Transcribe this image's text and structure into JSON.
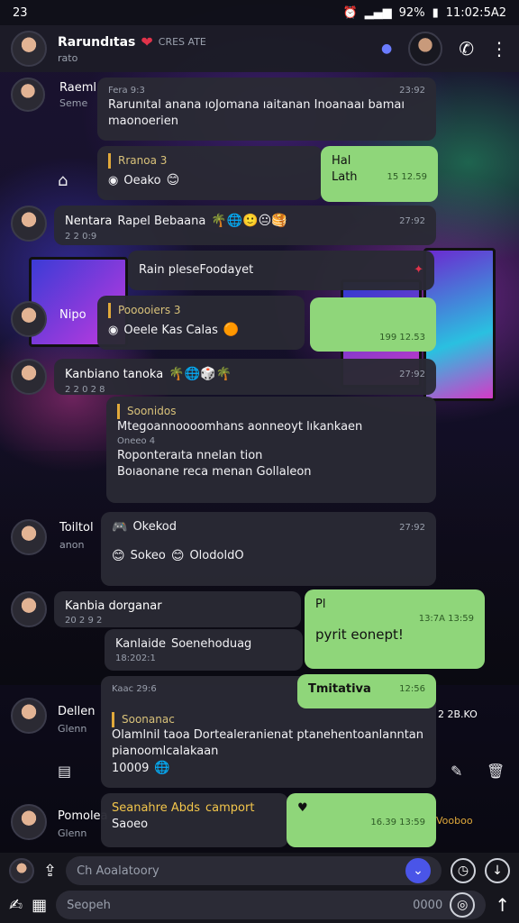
{
  "status": {
    "time": "23",
    "battery": "92%",
    "clock": "11:02:5A2"
  },
  "header": {
    "title": "Rarundıtas",
    "subtitle": "rato",
    "extra": "CRES ATE"
  },
  "messages": [
    {
      "side_name": "Raeml",
      "side_sub": "Seme",
      "time": "23:92",
      "sender": "Fera 9:3",
      "text": "Rarunıtal anana ıoJomana ıaitanan Inoanaaı bamaı maonoerien"
    },
    {
      "reply": "Rranoa 3",
      "sender": "Oeako",
      "time": ""
    },
    {
      "text_top": "Hal",
      "text_bottom": "Lath",
      "time": "15 12.59"
    },
    {
      "side_name": "Nentara",
      "side_sub": "2 2 0:9",
      "text": "Rapel Bebaana",
      "time": "27:92"
    },
    {
      "text": "Rain pleseFoodayet"
    },
    {
      "side_name": "Nipo",
      "reply": "Pooooiers 3",
      "sender": "Oeele Kas Calas"
    },
    {
      "time": "199 12.53"
    },
    {
      "side_name": "Kanbiano tanoka",
      "side_sub": "2 2 0 2 8",
      "time": "27:92",
      "reply": "Soonidos",
      "text1": "Mtegoannoooomhans aonneoyt lıkankaen",
      "meta1": "Oneeo 4",
      "text2": "Roponteraıta nnelan tion",
      "text3": "Boıaonane reca menan Gollaleon"
    },
    {
      "side_name": "Toiltol",
      "side_sub": "anon",
      "text": "Okekod",
      "time": "27:92",
      "text2": "Sokeo",
      "text3": "OlodoldO"
    },
    {
      "side_name": "Kanbia dorganar",
      "side_sub": "20 2 9 2",
      "reply": "Kanlaide",
      "sender": "Soenehoduag",
      "date": "18:202:1"
    },
    {
      "text": "Pl",
      "time": "13:7A 13:59",
      "text2": "pyrit eonept!"
    },
    {
      "title": "Kaac 29:6",
      "text": "Tmitativa",
      "time": "12:56",
      "reply": "Soonanac",
      "text2": "Olamlnil taoa Dortealeranienat ptanehentoanlanntan pianoomlcalakaan",
      "meta": "10009"
    },
    {
      "side_name": "Dellen",
      "side_sub": "Glenn",
      "extra": "2 2B.KO"
    },
    {
      "side_name": "Pomolea",
      "side_sub": "Glenn",
      "text": "Seanahre Abds",
      "text2": "camport",
      "meta": "Saoeo",
      "time": "16.39 13:59",
      "extra": "Vooboo"
    }
  ],
  "input": {
    "placeholder": "Ch Aoalatoory",
    "search_placeholder": "Seopeh",
    "count": "0000"
  }
}
